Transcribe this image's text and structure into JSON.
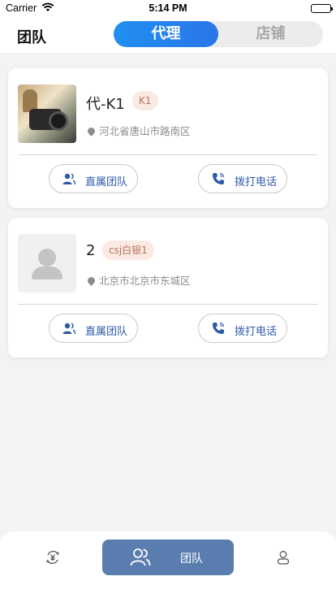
{
  "status_bar": {
    "carrier": "Carrier",
    "time": "5:14 PM"
  },
  "header": {
    "title": "团队",
    "tabs": [
      {
        "label": "代理",
        "active": true
      },
      {
        "label": "店铺",
        "active": false
      }
    ]
  },
  "members": [
    {
      "name": "代-K1",
      "level": "K1",
      "address": "河北省唐山市路南区",
      "avatar": "photo"
    },
    {
      "name": "2",
      "level": "csj白银1",
      "address": "北京市北京市东城区",
      "avatar": "default"
    }
  ],
  "actions": {
    "team": "直属团队",
    "call": "拨打电话"
  },
  "tabbar": {
    "items": [
      {
        "icon": "earnings-icon"
      },
      {
        "label": "团队",
        "icon": "team-icon",
        "active": true
      },
      {
        "icon": "profile-icon"
      }
    ]
  },
  "colors": {
    "accent": "#2b75e8",
    "tab_active_bg": "#5a7db0",
    "badge_bg": "#fbeae3",
    "badge_text": "#b4735c",
    "button_text": "#2f5aa8"
  }
}
